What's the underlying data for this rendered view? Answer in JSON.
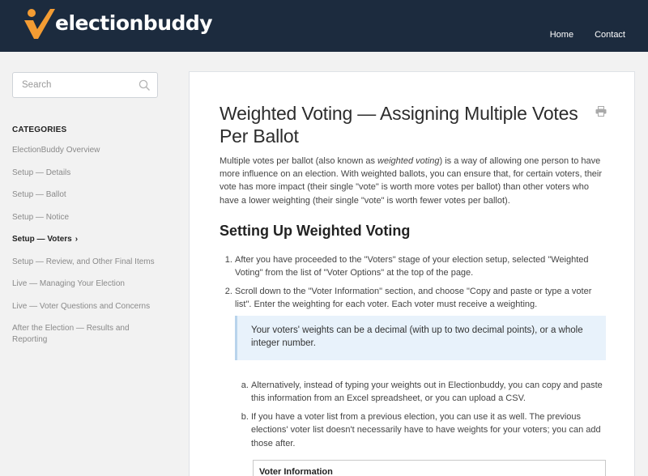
{
  "brand": {
    "name": "electionbuddy",
    "accent": "#f39c33",
    "header_bg": "#1c2b3e"
  },
  "topnav": {
    "items": [
      "Home",
      "Contact"
    ]
  },
  "search": {
    "placeholder": "Search",
    "icon": "search-icon"
  },
  "sidebar": {
    "heading": "CATEGORIES",
    "items": [
      {
        "label": "ElectionBuddy Overview"
      },
      {
        "label": "Setup — Details"
      },
      {
        "label": "Setup — Ballot"
      },
      {
        "label": "Setup — Notice"
      },
      {
        "label": "Setup — Voters",
        "active": true
      },
      {
        "label": "Setup — Review, and Other Final Items"
      },
      {
        "label": "Live — Managing Your Election"
      },
      {
        "label": "Live — Voter Questions and Concerns"
      },
      {
        "label": "After the Election — Results and Reporting"
      }
    ],
    "active_chevron": "›"
  },
  "article": {
    "title": "Weighted Voting — Assigning Multiple Votes Per Ballot",
    "intro_before": "Multiple votes per ballot (also known as ",
    "intro_em": "weighted voting",
    "intro_after": ") is a way of allowing one person to have more influence on an election. With weighted ballots, you can ensure that, for certain voters, their vote has more impact (their single \"vote\" is worth more votes per ballot) than other voters who have a lower weighting (their single \"vote\" is worth fewer votes per ballot).",
    "section_heading": "Setting Up Weighted Voting",
    "steps": [
      "After you have proceeded to the \"Voters\" stage of your election setup, selected \"Weighted Voting\" from the list of \"Voter Options\" at the top of the page.",
      "Scroll down to the \"Voter Information\" section, and choose \"Copy and paste or type a voter list\". Enter the weighting for each voter. Each voter must receive a weighting."
    ],
    "callout": "Your voters' weights can be a decimal (with up to two decimal points), or a whole integer number.",
    "substeps": [
      "Alternatively, instead of typing your weights out in Electionbuddy, you can copy and paste this information from an Excel spreadsheet, or you can upload a CSV.",
      "If you have a voter list from a previous election, you can use it as well. The previous elections' voter list doesn't necessarily have to have weights for your voters; you can add those after."
    ],
    "voter_box_label": "Voter Information"
  }
}
